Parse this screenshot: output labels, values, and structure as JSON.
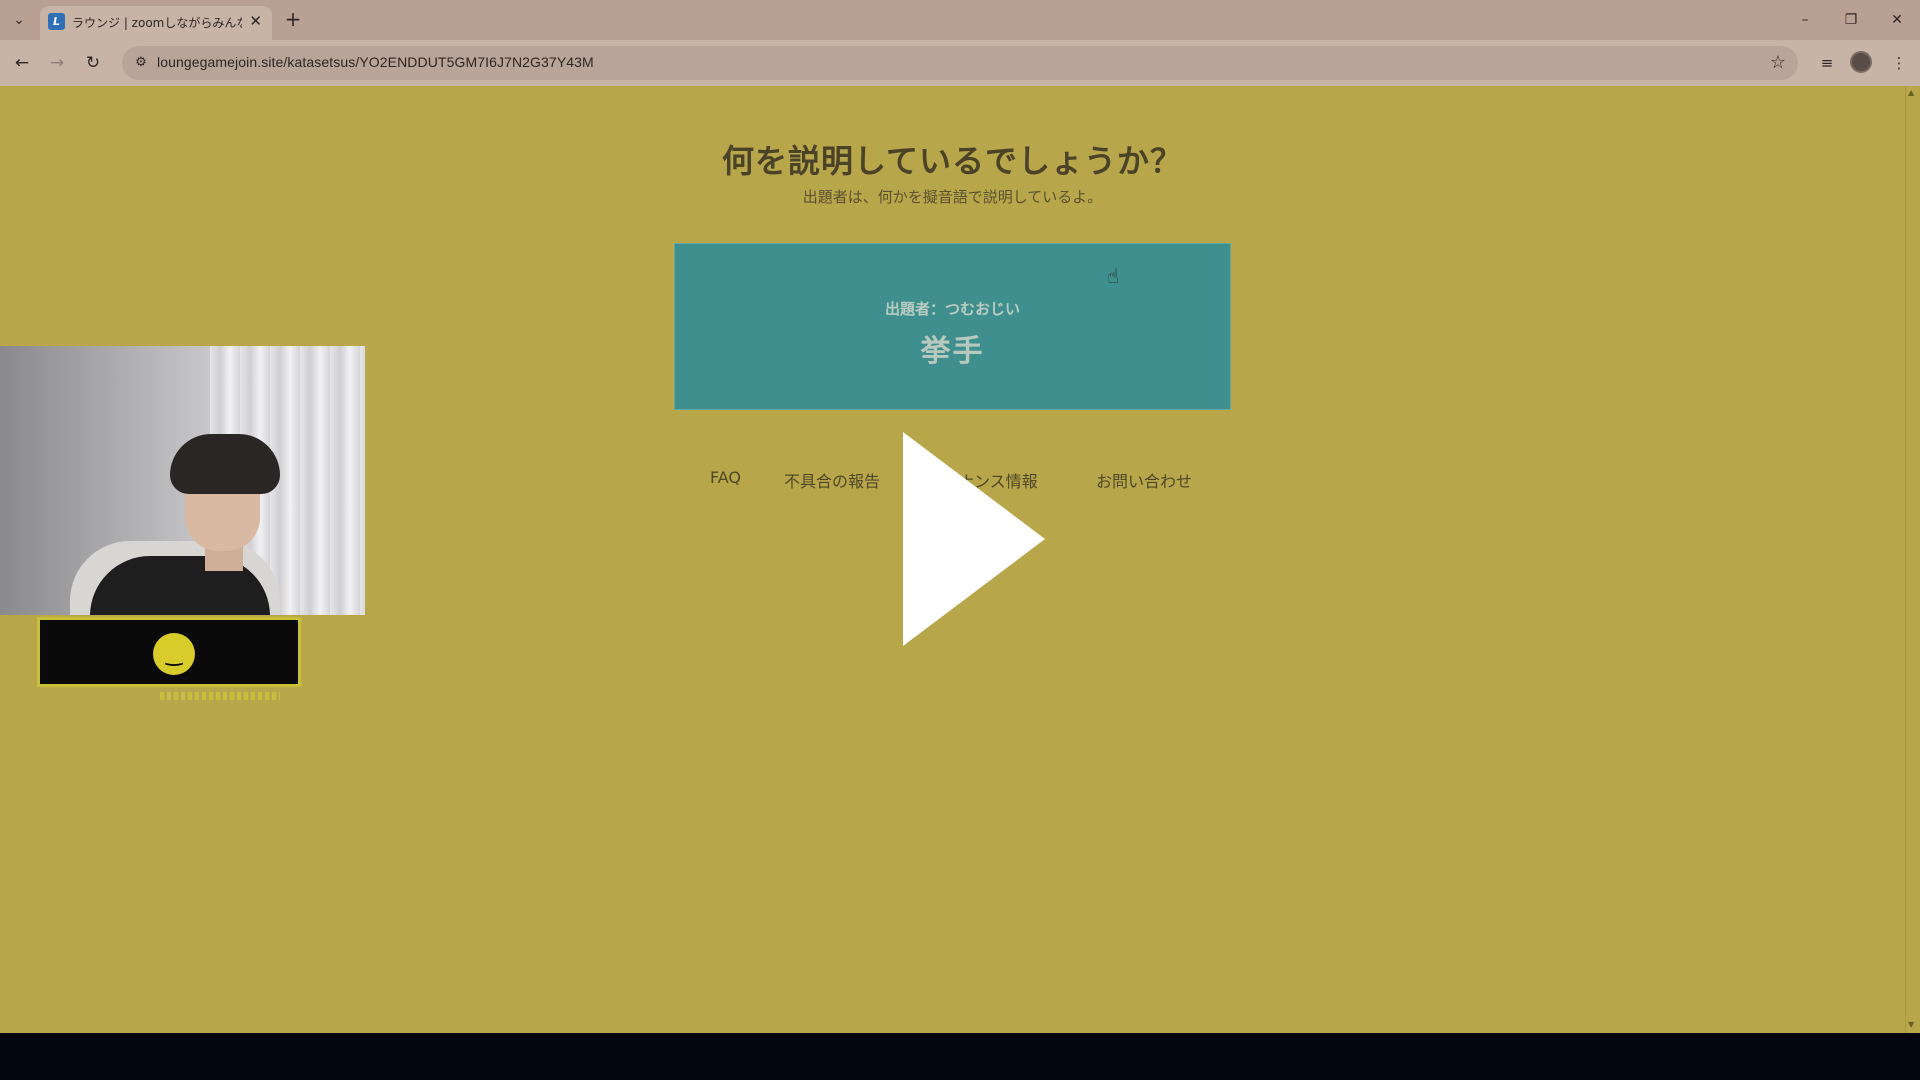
{
  "browser": {
    "tab_title": "ラウンジ | zoomしながらみんなで遊",
    "favicon_letter": "L",
    "url": "loungegamejoin.site/katasetsus/YO2ENDDUT5GM7I6J7N2G37Y43M",
    "icons": {
      "tab_list": "chevron-down-icon",
      "close_tab": "close-icon",
      "new_tab": "plus-icon",
      "back": "arrow-left-icon",
      "forward": "arrow-right-icon",
      "reload": "reload-icon",
      "site_info": "tune-icon",
      "bookmark": "star-icon",
      "media": "media-control-icon",
      "menu": "kebab-menu-icon",
      "minimize": "minimize-icon",
      "restore": "restore-icon",
      "close_window": "close-icon"
    }
  },
  "page": {
    "heading": "何を説明しているでしょうか？",
    "subheading": "出題者は、何かを擬音語で説明しているよ。",
    "card": {
      "setter_label": "出題者：つむおじい",
      "answer": "挙手"
    },
    "footer_links": [
      "FAQ",
      "不具合の報告",
      "メンテナンス情報",
      "お問い合わせ"
    ]
  },
  "overlay": {
    "play_icon": "play-icon",
    "emoji": "smiley-icon"
  },
  "colors": {
    "page_bg": "#b8a64a",
    "card_bg": "#3f8f8e",
    "chrome_bg": "#b8a093"
  }
}
